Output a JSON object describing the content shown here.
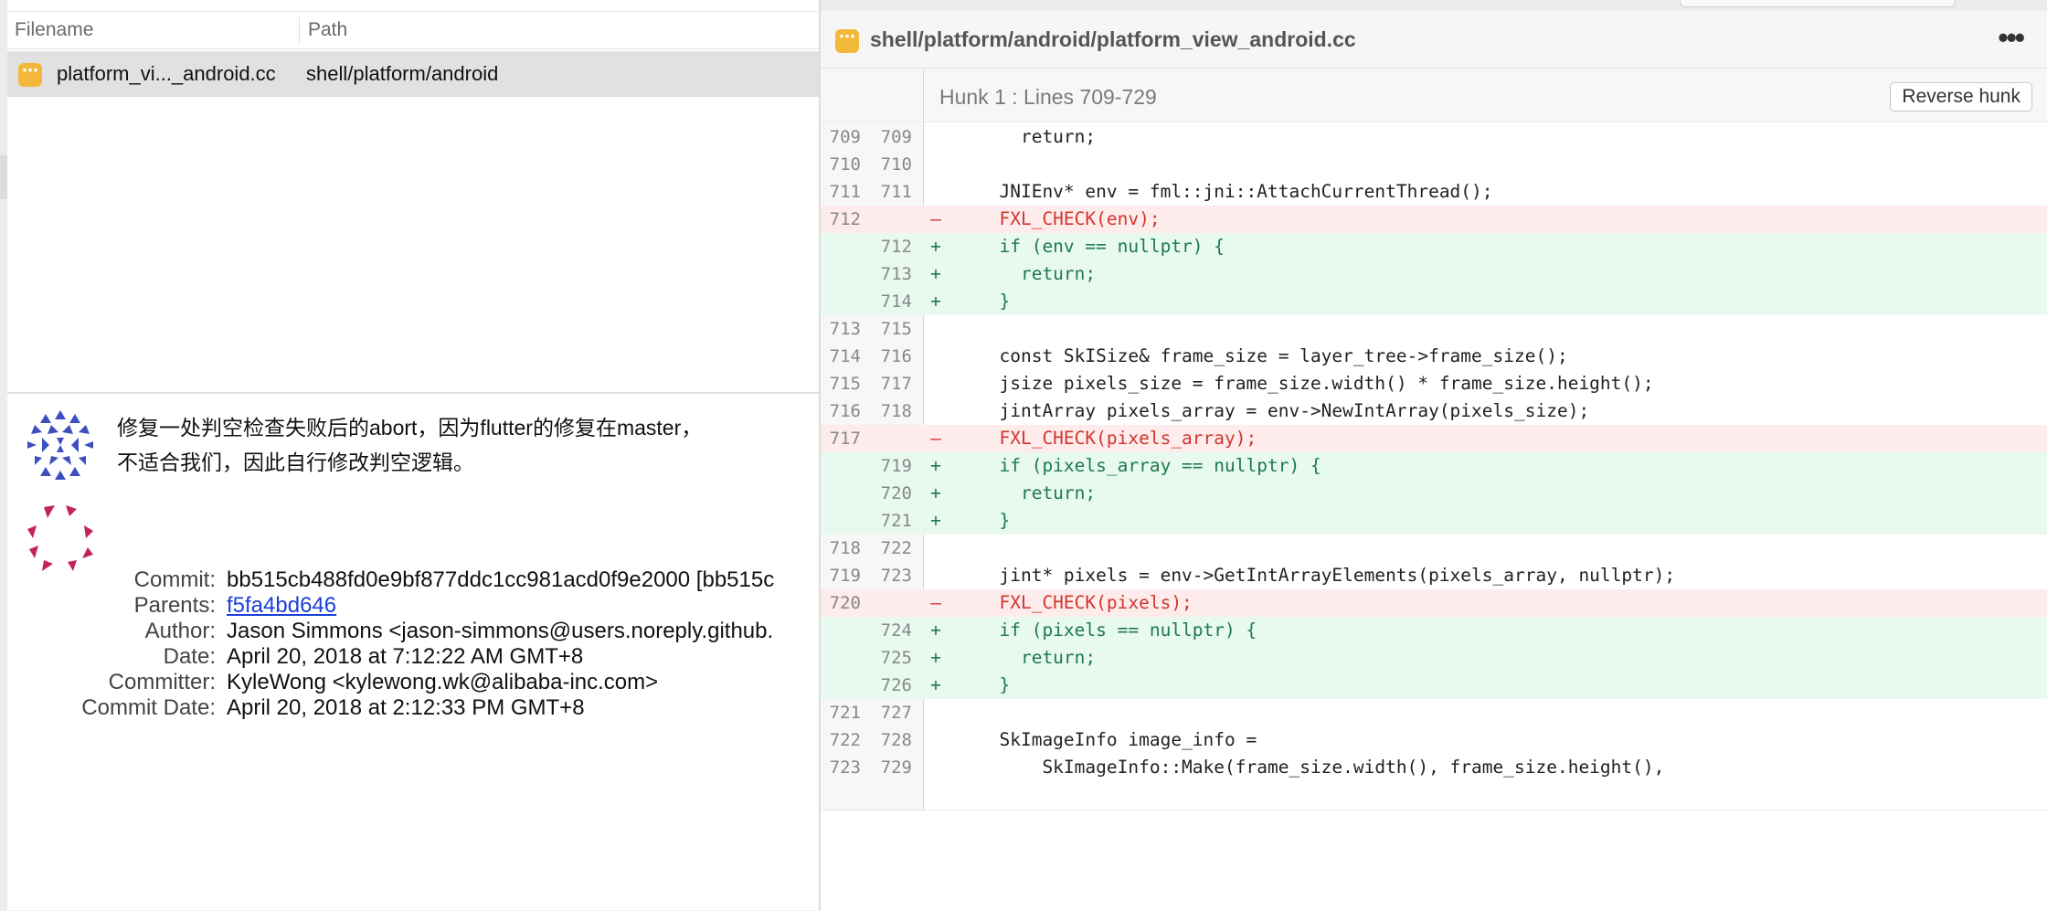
{
  "file_list": {
    "headers": {
      "filename": "Filename",
      "path": "Path"
    },
    "rows": [
      {
        "icon": "code-file-icon",
        "name": "platform_vi..._android.cc",
        "path": "shell/platform/android"
      }
    ]
  },
  "commit": {
    "message_lines": [
      "修复一处判空检查失败后的abort，因为flutter的修复在master，",
      "不适合我们，因此自行修改判空逻辑。"
    ],
    "fields": [
      {
        "label": "Commit:",
        "value": "bb515cb488fd0e9bf877ddc1cc981acd0f9e2000 [bb515c",
        "link": false
      },
      {
        "label": "Parents:",
        "value": "f5fa4bd646",
        "link": true
      },
      {
        "label": "Author:",
        "value": "Jason Simmons <jason-simmons@users.noreply.github.",
        "link": false
      },
      {
        "label": "Date:",
        "value": "April 20, 2018 at 7:12:22 AM GMT+8",
        "link": false
      },
      {
        "label": "Committer:",
        "value": "KyleWong <kylewong.wk@alibaba-inc.com>",
        "link": false
      },
      {
        "label": "Commit Date:",
        "value": "April 20, 2018 at 2:12:33 PM GMT+8",
        "link": false
      }
    ]
  },
  "diff": {
    "file_path": "shell/platform/android/platform_view_android.cc",
    "more_label": "•••",
    "hunk_label": "Hunk 1 : Lines 709-729",
    "reverse_button": "Reverse hunk",
    "lines": [
      {
        "type": "ctx",
        "old": "709",
        "new": "709",
        "text": "    return;"
      },
      {
        "type": "ctx",
        "old": "710",
        "new": "710",
        "text": ""
      },
      {
        "type": "ctx",
        "old": "711",
        "new": "711",
        "text": "  JNIEnv* env = fml::jni::AttachCurrentThread();"
      },
      {
        "type": "del",
        "old": "712",
        "new": "",
        "text": "  FXL_CHECK(env);"
      },
      {
        "type": "add",
        "old": "",
        "new": "712",
        "text": "  if (env == nullptr) {"
      },
      {
        "type": "add",
        "old": "",
        "new": "713",
        "text": "    return;"
      },
      {
        "type": "add",
        "old": "",
        "new": "714",
        "text": "  }"
      },
      {
        "type": "ctx",
        "old": "713",
        "new": "715",
        "text": ""
      },
      {
        "type": "ctx",
        "old": "714",
        "new": "716",
        "text": "  const SkISize& frame_size = layer_tree->frame_size();"
      },
      {
        "type": "ctx",
        "old": "715",
        "new": "717",
        "text": "  jsize pixels_size = frame_size.width() * frame_size.height();"
      },
      {
        "type": "ctx",
        "old": "716",
        "new": "718",
        "text": "  jintArray pixels_array = env->NewIntArray(pixels_size);"
      },
      {
        "type": "del",
        "old": "717",
        "new": "",
        "text": "  FXL_CHECK(pixels_array);"
      },
      {
        "type": "add",
        "old": "",
        "new": "719",
        "text": "  if (pixels_array == nullptr) {"
      },
      {
        "type": "add",
        "old": "",
        "new": "720",
        "text": "    return;"
      },
      {
        "type": "add",
        "old": "",
        "new": "721",
        "text": "  }"
      },
      {
        "type": "ctx",
        "old": "718",
        "new": "722",
        "text": ""
      },
      {
        "type": "ctx",
        "old": "719",
        "new": "723",
        "text": "  jint* pixels = env->GetIntArrayElements(pixels_array, nullptr);"
      },
      {
        "type": "del",
        "old": "720",
        "new": "",
        "text": "  FXL_CHECK(pixels);"
      },
      {
        "type": "add",
        "old": "",
        "new": "724",
        "text": "  if (pixels == nullptr) {"
      },
      {
        "type": "add",
        "old": "",
        "new": "725",
        "text": "    return;"
      },
      {
        "type": "add",
        "old": "",
        "new": "726",
        "text": "  }"
      },
      {
        "type": "ctx",
        "old": "721",
        "new": "727",
        "text": ""
      },
      {
        "type": "ctx",
        "old": "722",
        "new": "728",
        "text": "  SkImageInfo image_info ="
      },
      {
        "type": "ctx",
        "old": "723",
        "new": "729",
        "text": "      SkImageInfo::Make(frame_size.width(), frame_size.height(),"
      }
    ]
  },
  "colors": {
    "deleted_text": "#d0362f",
    "added_text": "#1e7a4d",
    "deleted_bg": "#fdeceb",
    "added_bg": "#e8f9ef",
    "file_icon": "#f3b83a",
    "link": "#1a3fd9"
  }
}
